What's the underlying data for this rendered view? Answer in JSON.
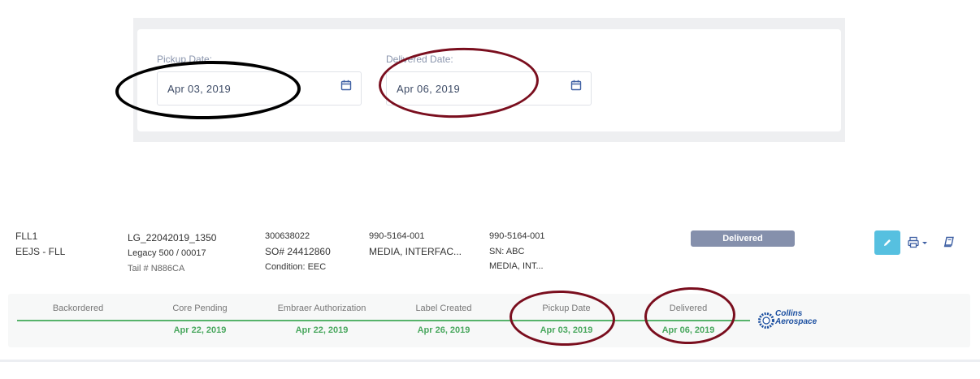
{
  "dates_panel": {
    "pickup": {
      "label": "Pickup Date:",
      "value": "Apr 03, 2019",
      "icon": "calendar-icon"
    },
    "delivered": {
      "label": "Delivered Date:",
      "value": "Apr 06, 2019",
      "icon": "calendar-icon"
    }
  },
  "shipment": {
    "location": {
      "code": "FLL1",
      "route": "EEJS - FLL"
    },
    "lot": {
      "id": "LG_22042019_1350",
      "aircraft": "Legacy 500 / 00017",
      "tail": "Tail # N886CA"
    },
    "order": {
      "number": "300638022",
      "so": "SO# 24412860",
      "condition": "Condition: EEC"
    },
    "part": {
      "number": "990-5164-001",
      "description": "MEDIA, INTERFAC..."
    },
    "part_installed": {
      "number": "990-5164-001",
      "serial": "SN: ABC",
      "description": "MEDIA, INT..."
    },
    "status": "Delivered",
    "actions": {
      "edit_icon": "pencil-icon",
      "print_icon": "printer-icon",
      "book_icon": "book-icon"
    }
  },
  "tracker": {
    "steps": [
      {
        "label": "Backordered",
        "date": ""
      },
      {
        "label": "Core Pending",
        "date": "Apr 22, 2019"
      },
      {
        "label": "Embraer Authorization",
        "date": "Apr 22, 2019"
      },
      {
        "label": "Label Created",
        "date": "Apr 26, 2019"
      },
      {
        "label": "Pickup Date",
        "date": "Apr 03, 2019"
      },
      {
        "label": "Delivered",
        "date": "Apr 06, 2019"
      }
    ],
    "logo": {
      "line1": "Collins",
      "line2": "Aerospace"
    }
  },
  "colors": {
    "status_badge": "#8590ac",
    "edit_button": "#56c0e0",
    "progress_green": "#57b36b",
    "annotation_black": "#000000",
    "annotation_red": "#7a0e1e"
  }
}
